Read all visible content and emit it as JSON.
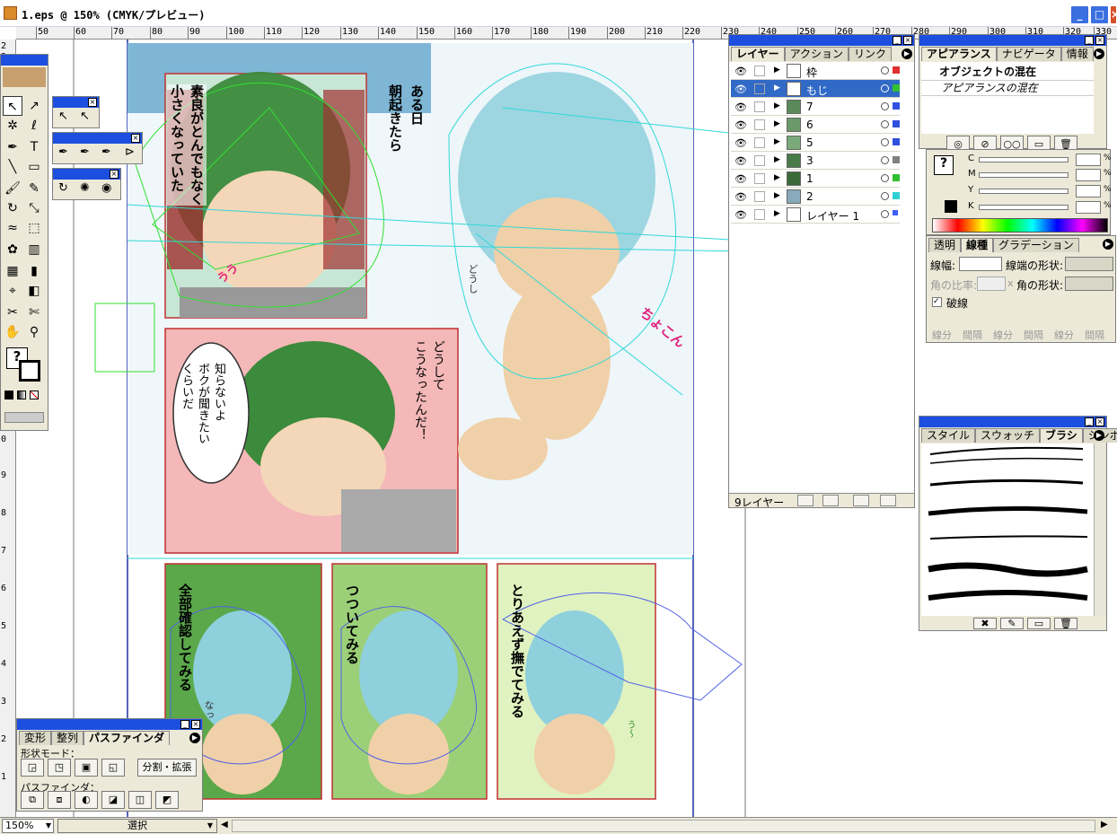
{
  "window": {
    "title": "1.eps @ 150% (CMYK/プレビュー)",
    "minimize": "_",
    "maximize": "□",
    "close": "×"
  },
  "ruler_h": [
    "50",
    "60",
    "70",
    "80",
    "90",
    "100",
    "110",
    "120",
    "130",
    "140",
    "150",
    "160",
    "170",
    "180",
    "190",
    "200",
    "210",
    "220",
    "230",
    "240",
    "250",
    "260",
    "270",
    "280",
    "290",
    "300",
    "310",
    "320",
    "330"
  ],
  "ruler_v": [
    "2",
    "3",
    "0",
    "9",
    "8",
    "7",
    "6",
    "5",
    "4",
    "3",
    "2",
    "1"
  ],
  "comic": {
    "text1": "ある日\n朝起きたら",
    "text2": "素良がとんでもなく\n小さくなっていた",
    "text3": "どうして\nこうなったんだ！",
    "text4": "知らないよ\nボクが聞きたい\nくらいだ",
    "text5": "全部確認してみる",
    "text6": "つついてみる",
    "text7": "とりあえず撫でてみる",
    "sfx1": "ちょこん",
    "sfx2": "うう",
    "sfx3": "どうし",
    "sfx4": "なっ",
    "sfx5": "う〜"
  },
  "layers_panel": {
    "tabs": [
      "レイヤー",
      "アクション",
      "リンク"
    ],
    "layers": [
      {
        "name": "枠",
        "color": "#e03030",
        "selected": false
      },
      {
        "name": "もじ",
        "color": "#30c030",
        "selected": true
      },
      {
        "name": "7",
        "color": "#3050e0",
        "selected": false
      },
      {
        "name": "6",
        "color": "#3050e0",
        "selected": false
      },
      {
        "name": "5",
        "color": "#3050e0",
        "selected": false
      },
      {
        "name": "3",
        "color": "#808080",
        "selected": false
      },
      {
        "name": "1",
        "color": "#30c030",
        "selected": false
      },
      {
        "name": "2",
        "color": "#30d0d0",
        "selected": false
      },
      {
        "name": "レイヤー 1",
        "color": "#4060ff",
        "selected": false
      }
    ],
    "count": "9レイヤー"
  },
  "appearance_panel": {
    "tabs": [
      "アピアランス",
      "ナビゲータ",
      "情報"
    ],
    "header": "オブジェクトの混在",
    "item": "アピアランスの混在"
  },
  "color_panel": {
    "channels": [
      "C",
      "M",
      "Y",
      "K"
    ],
    "unit": "%"
  },
  "stroke_panel": {
    "tabs": [
      "透明",
      "線種",
      "グラデーション"
    ],
    "weight_label": "線幅:",
    "cap_label": "線端の形状:",
    "miter_label": "角の比率:",
    "join_label": "角の形状:",
    "dashed_label": "破線",
    "dash_labels": [
      "線分",
      "間隔",
      "線分",
      "間隔",
      "線分",
      "間隔"
    ],
    "miter_x": "x"
  },
  "brush_panel": {
    "tabs": [
      "スタイル",
      "スウォッチ",
      "ブラシ",
      "シンボル"
    ]
  },
  "pathfinder_panel": {
    "tabs": [
      "変形",
      "整列",
      "パスファインダ"
    ],
    "shape_mode_label": "形状モード：",
    "expand_button": "分割・拡張",
    "pathfinder_label": "パスファインダ："
  },
  "status": {
    "zoom": "150%",
    "tool": "選択"
  },
  "colors": {
    "sky": "#7fb6d6",
    "panel_bg": "#ece9d8",
    "title_blue": "#1c4fdf",
    "green_panel": "#5aa84a",
    "light_green": "#9bd078",
    "pale_green": "#e0f2c0",
    "pink_panel": "#f4b8b8"
  }
}
